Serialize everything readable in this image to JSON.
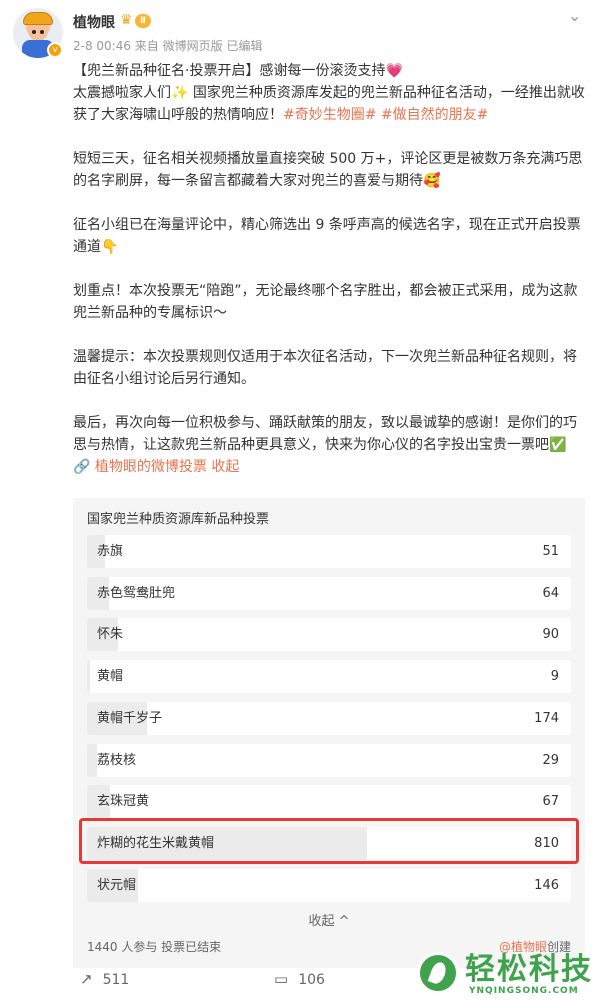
{
  "header": {
    "username": "植物眼",
    "level_badge": "Ⅱ",
    "meta": "2-8 00:46 来自 微博网页版 已编辑",
    "vip_badge": "v"
  },
  "post": {
    "lines": [
      {
        "parts": [
          {
            "t": "【兜兰新品种征名·投票开启】感谢每一份滚烫支持"
          },
          {
            "t": "💗",
            "c": "heart"
          }
        ]
      },
      {
        "parts": [
          {
            "t": "太震撼啦家人们✨ 国家兜兰种质资源库发起的兜兰新品种征名活动，一经推出就收获了大家海啸山呼般的热情响应！"
          },
          {
            "t": "#奇妙生物圈#",
            "c": "hashtag"
          },
          {
            "t": " "
          },
          {
            "t": "#做自然的朋友#",
            "c": "hashtag"
          }
        ]
      },
      {
        "gap": true
      },
      {
        "parts": [
          {
            "t": "短短三天，征名相关视频播放量直接突破 500 万+，评论区更是被数万条充满巧思的名字刷屏，每一条留言都藏着大家对兜兰的喜爱与期待🥰"
          }
        ]
      },
      {
        "gap": true
      },
      {
        "parts": [
          {
            "t": "征名小组已在海量评论中，精心筛选出 9 条呼声高的候选名字，现在正式开启投票通道👇"
          }
        ]
      },
      {
        "gap": true
      },
      {
        "parts": [
          {
            "t": "划重点！本次投票无“陪跑”，无论最终哪个名字胜出，都会被正式采用，成为这款兜兰新品种的专属标识～"
          }
        ]
      },
      {
        "gap": true
      },
      {
        "parts": [
          {
            "t": "温馨提示：本次投票规则仅适用于本次征名活动，下一次兜兰新品种征名规则，将由征名小组讨论后另行通知。"
          }
        ]
      },
      {
        "gap": true
      },
      {
        "parts": [
          {
            "t": "最后，再次向每一位积极参与、踊跃献策的朋友，致以最诚挚的感谢！是你们的巧思与热情，让这款兜兰新品种更具意义，快来为你心仪的名字投出宝贵一票吧✅"
          }
        ]
      },
      {
        "parts": [
          {
            "t": "🔗 植物眼的微博投票 收起",
            "c": "vote-link"
          }
        ]
      }
    ]
  },
  "vote": {
    "title": "国家兜兰种质资源库新品种投票",
    "total": 1440,
    "options": [
      {
        "label": "赤旗",
        "count": 51
      },
      {
        "label": "赤色鸳鸯肚兜",
        "count": 64
      },
      {
        "label": "怀朱",
        "count": 90
      },
      {
        "label": "黄帽",
        "count": 9
      },
      {
        "label": "黄帽千岁子",
        "count": 174
      },
      {
        "label": "荔枝核",
        "count": 29
      },
      {
        "label": "玄珠冠黄",
        "count": 67
      },
      {
        "label": "炸糊的花生米戴黄帽",
        "count": 810
      },
      {
        "label": "状元帽",
        "count": 146
      }
    ],
    "collapse_label": "收起 ^",
    "stats": "1440 人参与 投票已结束",
    "creator_name": "@植物眼",
    "creator_suffix": "创建"
  },
  "actions": {
    "repost_count": "511",
    "comment_count": "106"
  },
  "watermark": {
    "text": "轻松科技",
    "sub": "YNQINGSONG.COM"
  },
  "colors": {
    "accent": "#eb7350",
    "highlight": "#e53935",
    "watermark": "#3fa34d"
  }
}
